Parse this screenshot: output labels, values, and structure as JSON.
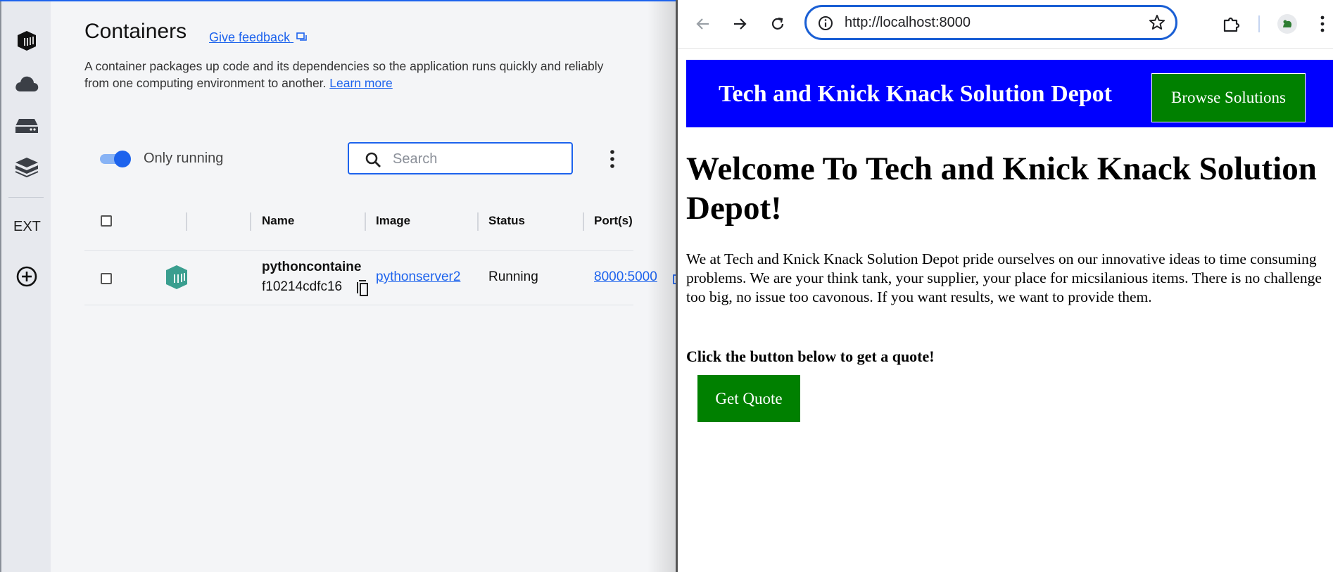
{
  "docker": {
    "sidebar": {
      "items": [
        {
          "icon": "containers-icon",
          "label": "Containers"
        },
        {
          "icon": "cloud-icon",
          "label": "Cloud"
        },
        {
          "icon": "volumes-icon",
          "label": "Volumes"
        },
        {
          "icon": "builds-icon",
          "label": "Builds"
        }
      ],
      "ext_label": "EXT",
      "add_icon": "add-extension-icon"
    },
    "title": "Containers",
    "feedback_label": "Give feedback",
    "description": "A container packages up code and its dependencies so the application runs quickly and reliably from one computing environment to another.",
    "learn_more": "Learn more",
    "only_running_label": "Only running",
    "only_running_checked": true,
    "search_placeholder": "Search",
    "table": {
      "columns": [
        "Name",
        "Image",
        "Status",
        "Port(s)"
      ],
      "rows": [
        {
          "name": "pythoncontaine",
          "id": "f10214cdfc16",
          "image": "pythonserver2",
          "status": "Running",
          "ports": "8000:5000"
        }
      ]
    },
    "accent_color": "#1d63ed"
  },
  "browser": {
    "url": "http://localhost:8000",
    "page": {
      "banner_title": "Tech and Knick Knack Solution Depot",
      "browse_button": "Browse Solutions",
      "heading": "Welcome To Tech and Knick Knack Solution Depot!",
      "paragraph": "We at Tech and Knick Knack Solution Depot pride ourselves on our innovative ideas to time consuming problems. We are your think tank, your supplier, your place for micsilanious items. There is no challenge too big, no issue too cavonous. If you want results, we want to provide them.",
      "cta_text": "Click the button below to get a quote!",
      "quote_button": "Get Quote",
      "banner_color": "#0000ff",
      "button_color": "#008000"
    }
  }
}
